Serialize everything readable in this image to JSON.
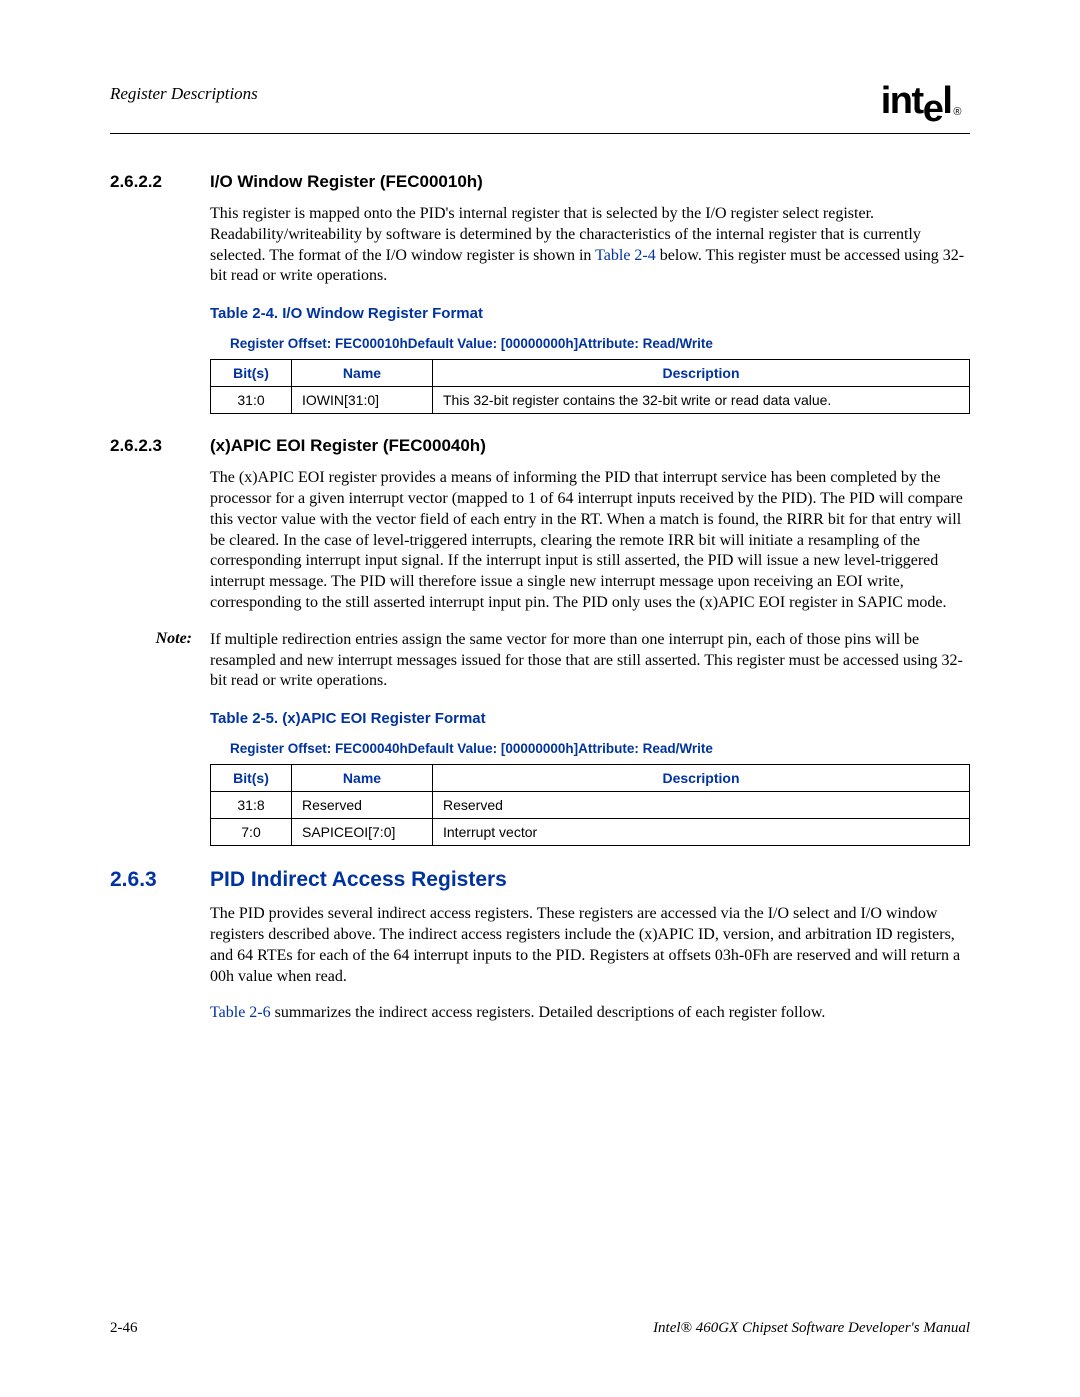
{
  "header": {
    "running_head": "Register Descriptions",
    "logo_pre": "int",
    "logo_sub": "e",
    "logo_post": "l",
    "logo_reg": "®"
  },
  "sec_26222": {
    "num": "2.6.2.2",
    "title": "I/O Window Register (FEC00010h)",
    "para_a": "This register is mapped onto the PID's internal register that is selected by the I/O register select register. Readability/writeability by software is determined by the characteristics of the internal register that is currently selected. The format of the I/O window register is shown in ",
    "para_link": "Table 2-4",
    "para_b": " below. This register must be accessed using 32-bit read or write operations.",
    "table_caption": "Table 2-4. I/O Window Register Format",
    "reg_meta": "Register Offset: FEC00010hDefault Value: [00000000h]Attribute: Read/Write",
    "th_bits": "Bit(s)",
    "th_name": "Name",
    "th_desc": "Description",
    "rows": [
      {
        "bits": "31:0",
        "name": "IOWIN[31:0]",
        "desc": "This 32-bit register contains the 32-bit write or read data value."
      }
    ]
  },
  "sec_26223": {
    "num": "2.6.2.3",
    "title": "(x)APIC EOI Register (FEC00040h)",
    "para": "The (x)APIC EOI register provides a means of informing the PID that interrupt service has been completed by the processor for a given interrupt vector (mapped to 1 of 64 interrupt inputs received by the PID). The PID will compare this vector value with the vector field of each entry in the RT. When a match is found, the RIRR bit for that entry will be cleared. In the case of level-triggered interrupts, clearing the remote IRR bit will initiate a resampling of the corresponding interrupt input signal. If the interrupt input is still asserted, the PID will issue a new level-triggered interrupt message. The PID will therefore issue a single new interrupt message upon receiving an EOI write, corresponding to the still asserted interrupt input pin. The PID only uses the (x)APIC EOI register in SAPIC mode.",
    "note_label": "Note:",
    "note_body": "If multiple redirection entries assign the same vector for more than one interrupt pin, each of those pins will be resampled and new interrupt messages issued for those that are still asserted. This register must be accessed using 32-bit read or write operations.",
    "table_caption": "Table 2-5. (x)APIC EOI Register Format",
    "reg_meta": "Register Offset: FEC00040hDefault Value: [00000000h]Attribute: Read/Write",
    "th_bits": "Bit(s)",
    "th_name": "Name",
    "th_desc": "Description",
    "rows": [
      {
        "bits": "31:8",
        "name": "Reserved",
        "desc": "Reserved"
      },
      {
        "bits": "7:0",
        "name": "SAPICEOI[7:0]",
        "desc": "Interrupt vector"
      }
    ]
  },
  "sec_263": {
    "num": "2.6.3",
    "title": "PID Indirect Access Registers",
    "para1": "The PID provides several indirect access registers. These registers are accessed via the I/O select and I/O window registers described above. The indirect access registers include the (x)APIC ID, version, and arbitration ID registers, and 64 RTEs for each of the 64 interrupt inputs to the PID. Registers at offsets 03h-0Fh are reserved and will return a 00h value when read.",
    "para2_link": "Table 2-6",
    "para2_rest": " summarizes the indirect access registers. Detailed descriptions of each register follow."
  },
  "footer": {
    "page_num": "2-46",
    "intel": "Intel®",
    "product": " 460GX Chipset Software Developer's Manual"
  }
}
